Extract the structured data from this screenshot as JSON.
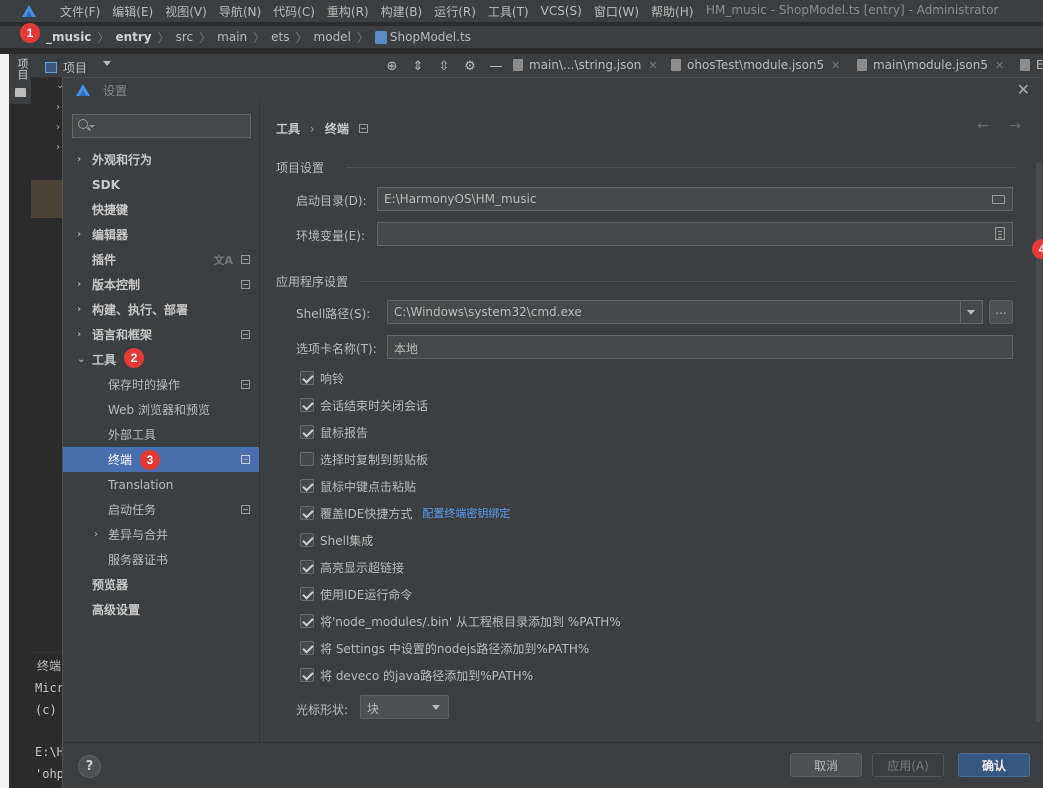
{
  "menubar": {
    "items": [
      "文件(F)",
      "编辑(E)",
      "视图(V)",
      "导航(N)",
      "代码(C)",
      "重构(R)",
      "构建(B)",
      "运行(R)",
      "工具(T)",
      "VCS(S)",
      "窗口(W)",
      "帮助(H)"
    ],
    "window_title": "HM_music - ShopModel.ts [entry] - Administrator"
  },
  "breadcrumb": {
    "items": [
      "_music",
      "entry",
      "src",
      "main",
      "ets",
      "model",
      "ShopModel.ts"
    ]
  },
  "badges": {
    "b1": "1",
    "b2": "2",
    "b3": "3",
    "b4": "4"
  },
  "toolwindow": {
    "vertical_label": "项目",
    "project_title": "项目",
    "tabs": [
      "main\\...\\string.json",
      "ohosTest\\module.json5",
      "main\\module.json5",
      "E"
    ]
  },
  "terminal_peek": {
    "label": "终端:",
    "lines": [
      "Micr",
      "(c)",
      "E:\\H",
      "'ohp"
    ]
  },
  "dialog": {
    "title": "设置",
    "search_placeholder": "",
    "tree": [
      {
        "label": "外观和行为",
        "chevron": "›"
      },
      {
        "label": "SDK"
      },
      {
        "label": "快捷键"
      },
      {
        "label": "编辑器",
        "chevron": "›"
      },
      {
        "label": "插件"
      },
      {
        "label": "版本控制",
        "chevron": "›"
      },
      {
        "label": "构建、执行、部署",
        "chevron": "›"
      },
      {
        "label": "语言和框架",
        "chevron": "›"
      },
      {
        "label": "工具",
        "chevron": "⌄"
      },
      {
        "label": "保存时的操作"
      },
      {
        "label": "Web 浏览器和预览"
      },
      {
        "label": "外部工具"
      },
      {
        "label": "终端"
      },
      {
        "label": "Translation"
      },
      {
        "label": "启动任务"
      },
      {
        "label": "差异与合并",
        "chevron": "›"
      },
      {
        "label": "服务器证书"
      },
      {
        "label": "预览器"
      },
      {
        "label": "高级设置"
      }
    ],
    "header": {
      "parent": "工具",
      "sep": "›",
      "current": "终端"
    },
    "nav_arrows": "← →",
    "project_section": "项目设置",
    "startup_dir_label": "启动目录(D):",
    "startup_dir_value": "E:\\HarmonyOS\\HM_music",
    "env_label": "环境变量(E):",
    "env_value": "",
    "app_section": "应用程序设置",
    "shell_label": "Shell路径(S):",
    "shell_value": "C:\\Windows\\system32\\cmd.exe",
    "browse_label": "...",
    "tabname_label": "选项卡名称(T):",
    "tabname_value": "本地",
    "checks": [
      {
        "label": "响铃",
        "checked": true
      },
      {
        "label": "会话结束时关闭会话",
        "checked": true
      },
      {
        "label": "鼠标报告",
        "checked": true
      },
      {
        "label": "选择时复制到剪贴板",
        "checked": false
      },
      {
        "label": "鼠标中键点击粘贴",
        "checked": true
      },
      {
        "label": "覆盖IDE快捷方式",
        "checked": true,
        "link": "配置终端密钥绑定"
      },
      {
        "label": "Shell集成",
        "checked": true
      },
      {
        "label": "高亮显示超链接",
        "checked": true
      },
      {
        "label": "使用IDE运行命令",
        "checked": true
      },
      {
        "label": "将'node_modules/.bin' 从工程根目录添加到 %PATH%",
        "checked": true
      },
      {
        "label": "将 Settings 中设置的nodejs路径添加到%PATH%",
        "checked": true
      },
      {
        "label": "将 deveco 的java路径添加到%PATH%",
        "checked": true
      }
    ],
    "cursor_label": "光标形状:",
    "cursor_value": "块",
    "help": "?",
    "cancel": "取消",
    "apply": "应用(A)",
    "ok": "确认"
  }
}
